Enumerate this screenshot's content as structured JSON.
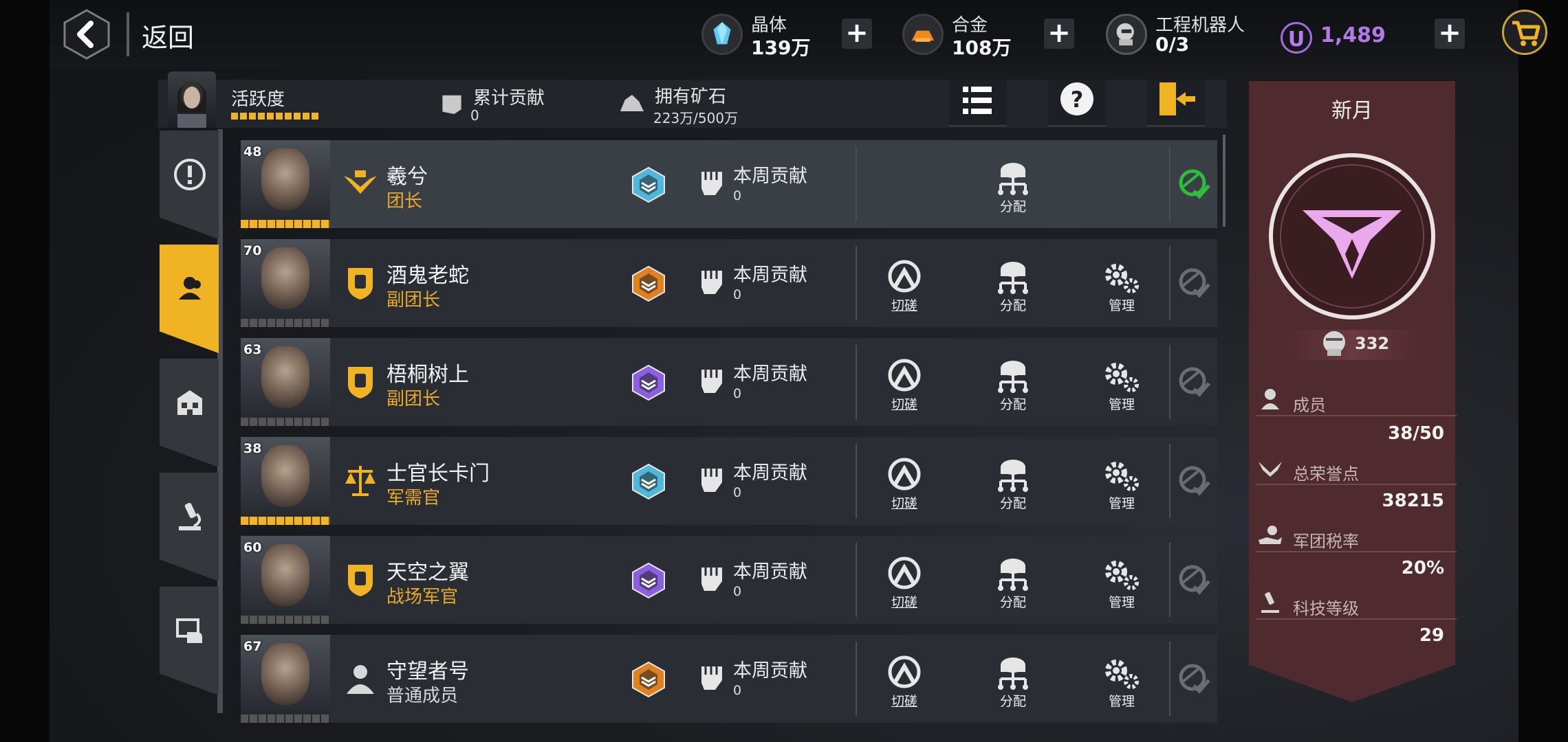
{
  "header": {
    "back_label": "返回",
    "resources": [
      {
        "name": "晶体",
        "value": "139万",
        "icon": "crystal-icon"
      },
      {
        "name": "合金",
        "value": "108万",
        "icon": "alloy-icon"
      },
      {
        "name": "工程机器人",
        "value": "0/3",
        "icon": "robot-icon"
      }
    ],
    "premium_value": "1,489",
    "premium_icon_text": "U"
  },
  "info": {
    "activity_label": "活跃度",
    "total_contribution_label": "累计贡献",
    "total_contribution_value": "0",
    "ore_label": "拥有矿石",
    "ore_value": "223万/500万"
  },
  "members": [
    {
      "level": "48",
      "name": "羲兮",
      "role": "团长",
      "weekly_label": "本周贡献",
      "weekly_value": "0",
      "actions": [
        "分配"
      ],
      "badge_color": "#4fb8d8",
      "rank_icon": "leader-wings-icon",
      "highlight": true,
      "online": true
    },
    {
      "level": "70",
      "name": "酒鬼老蛇",
      "role": "副团长",
      "weekly_label": "本周贡献",
      "weekly_value": "0",
      "actions": [
        "切磋",
        "分配",
        "管理"
      ],
      "badge_color": "#e0801e",
      "rank_icon": "shield-fist-icon",
      "online": false
    },
    {
      "level": "63",
      "name": "梧桐树上",
      "role": "副团长",
      "weekly_label": "本周贡献",
      "weekly_value": "0",
      "actions": [
        "切磋",
        "分配",
        "管理"
      ],
      "badge_color": "#8b5fe0",
      "rank_icon": "shield-fist-icon",
      "online": false
    },
    {
      "level": "38",
      "name": "士官长卡门",
      "role": "军需官",
      "weekly_label": "本周贡献",
      "weekly_value": "0",
      "actions": [
        "切磋",
        "分配",
        "管理"
      ],
      "badge_color": "#4fb8d8",
      "rank_icon": "scales-icon",
      "online": false
    },
    {
      "level": "60",
      "name": "天空之翼",
      "role": "战场军官",
      "weekly_label": "本周贡献",
      "weekly_value": "0",
      "actions": [
        "切磋",
        "分配",
        "管理"
      ],
      "badge_color": "#8b5fe0",
      "rank_icon": "shield-star-icon",
      "online": false
    },
    {
      "level": "67",
      "name": "守望者号",
      "role": "普通成员",
      "weekly_label": "本周贡献",
      "weekly_value": "0",
      "actions": [
        "切磋",
        "分配",
        "管理"
      ],
      "badge_color": "#e0801e",
      "rank_icon": "person-icon",
      "online": false
    }
  ],
  "legion": {
    "name": "新月",
    "points": "332",
    "stats": [
      {
        "label": "成员",
        "value": "38/50",
        "icon": "member-icon"
      },
      {
        "label": "总荣誉点",
        "value": "38215",
        "icon": "honor-wings-icon"
      },
      {
        "label": "军团税率",
        "value": "20%",
        "icon": "tax-hand-icon"
      },
      {
        "label": "科技等级",
        "value": "29",
        "icon": "microscope-icon"
      }
    ]
  },
  "colors": {
    "accent": "#f0b323",
    "role": "#e7a92d",
    "premium": "#b07ae8",
    "panel": "#4f2a2e"
  }
}
